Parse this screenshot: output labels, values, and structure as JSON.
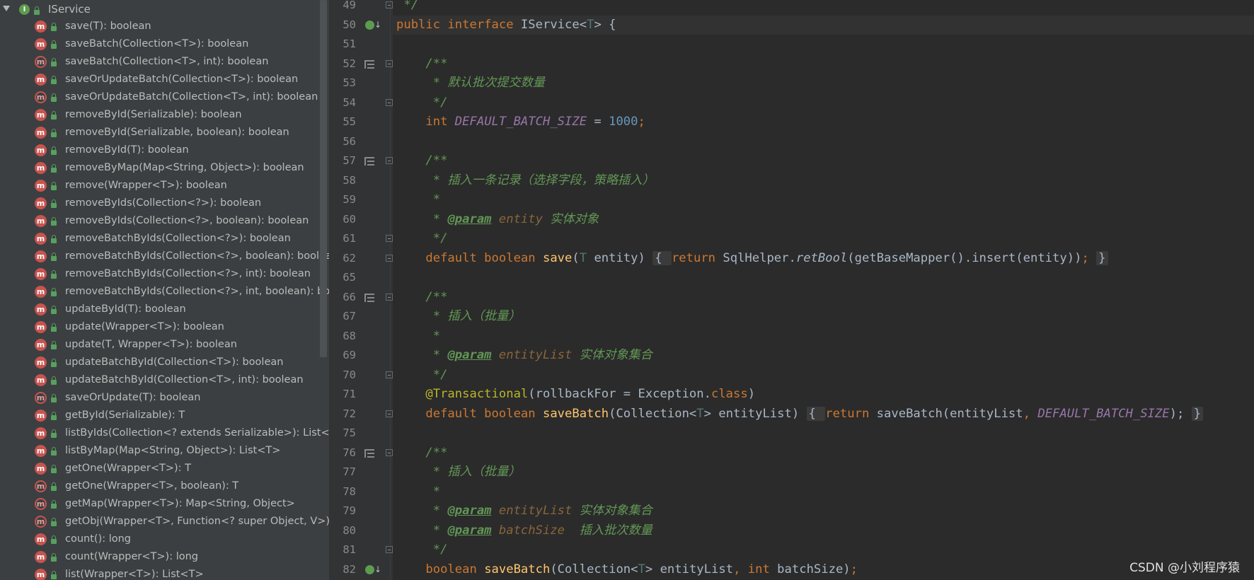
{
  "structure": {
    "root_label": "IService",
    "root_icon_letter": "I",
    "members": [
      {
        "label": "save(T): boolean",
        "abstract": false
      },
      {
        "label": "saveBatch(Collection<T>): boolean",
        "abstract": false
      },
      {
        "label": "saveBatch(Collection<T>, int): boolean",
        "abstract": true
      },
      {
        "label": "saveOrUpdateBatch(Collection<T>): boolean",
        "abstract": false
      },
      {
        "label": "saveOrUpdateBatch(Collection<T>, int): boolean",
        "abstract": true
      },
      {
        "label": "removeById(Serializable): boolean",
        "abstract": false
      },
      {
        "label": "removeById(Serializable, boolean): boolean",
        "abstract": false
      },
      {
        "label": "removeById(T): boolean",
        "abstract": false
      },
      {
        "label": "removeByMap(Map<String, Object>): boolean",
        "abstract": false
      },
      {
        "label": "remove(Wrapper<T>): boolean",
        "abstract": false
      },
      {
        "label": "removeByIds(Collection<?>): boolean",
        "abstract": false
      },
      {
        "label": "removeByIds(Collection<?>, boolean): boolean",
        "abstract": false
      },
      {
        "label": "removeBatchByIds(Collection<?>): boolean",
        "abstract": false
      },
      {
        "label": "removeBatchByIds(Collection<?>, boolean): boolea",
        "abstract": false
      },
      {
        "label": "removeBatchByIds(Collection<?>, int): boolean",
        "abstract": false
      },
      {
        "label": "removeBatchByIds(Collection<?>, int, boolean): bo",
        "abstract": false
      },
      {
        "label": "updateById(T): boolean",
        "abstract": false
      },
      {
        "label": "update(Wrapper<T>): boolean",
        "abstract": false
      },
      {
        "label": "update(T, Wrapper<T>): boolean",
        "abstract": false
      },
      {
        "label": "updateBatchById(Collection<T>): boolean",
        "abstract": false
      },
      {
        "label": "updateBatchById(Collection<T>, int): boolean",
        "abstract": false
      },
      {
        "label": "saveOrUpdate(T): boolean",
        "abstract": true
      },
      {
        "label": "getById(Serializable): T",
        "abstract": false
      },
      {
        "label": "listByIds(Collection<? extends Serializable>): List<T",
        "abstract": false
      },
      {
        "label": "listByMap(Map<String, Object>): List<T>",
        "abstract": false
      },
      {
        "label": "getOne(Wrapper<T>): T",
        "abstract": false
      },
      {
        "label": "getOne(Wrapper<T>, boolean): T",
        "abstract": true
      },
      {
        "label": "getMap(Wrapper<T>): Map<String, Object>",
        "abstract": true
      },
      {
        "label": "getObj(Wrapper<T>, Function<? super Object, V>)",
        "abstract": true
      },
      {
        "label": "count(): long",
        "abstract": false
      },
      {
        "label": "count(Wrapper<T>): long",
        "abstract": false
      },
      {
        "label": "list(Wrapper<T>): List<T>",
        "abstract": false
      }
    ],
    "member_icon_letter": "m"
  },
  "editor": {
    "line_numbers": [
      "49",
      "50",
      "51",
      "52",
      "53",
      "54",
      "55",
      "56",
      "57",
      "58",
      "59",
      "60",
      "61",
      "62",
      "65",
      "66",
      "67",
      "68",
      "69",
      "70",
      "71",
      "72",
      "75",
      "76",
      "77",
      "78",
      "79",
      "80",
      "81",
      "82"
    ],
    "lines": [
      [
        {
          "t": " */",
          "c": "doc"
        }
      ],
      [
        {
          "t": "public interface ",
          "c": "kw"
        },
        {
          "t": "IService",
          "c": "type"
        },
        {
          "t": "<",
          "c": ""
        },
        {
          "t": "T",
          "c": "tp"
        },
        {
          "t": "> {",
          "c": ""
        }
      ],
      [],
      [
        {
          "t": "    /**",
          "c": "doc"
        }
      ],
      [
        {
          "t": "     * 默认批次提交数量",
          "c": "doc"
        }
      ],
      [
        {
          "t": "     */",
          "c": "doc"
        }
      ],
      [
        {
          "t": "    int ",
          "c": "kw"
        },
        {
          "t": "DEFAULT_BATCH_SIZE",
          "c": "const"
        },
        {
          "t": " = ",
          "c": ""
        },
        {
          "t": "1000",
          "c": "num"
        },
        {
          "t": ";",
          "c": "kw"
        }
      ],
      [],
      [
        {
          "t": "    /**",
          "c": "doc"
        }
      ],
      [
        {
          "t": "     * 插入一条记录（选择字段，策略插入）",
          "c": "doc"
        }
      ],
      [
        {
          "t": "     *",
          "c": "doc"
        }
      ],
      [
        {
          "t": "     * ",
          "c": "doc"
        },
        {
          "t": "@param",
          "c": "tag"
        },
        {
          "t": " ",
          "c": "doc"
        },
        {
          "t": "entity",
          "c": "pname"
        },
        {
          "t": " 实体对象",
          "c": "doc"
        }
      ],
      [
        {
          "t": "     */",
          "c": "doc"
        }
      ],
      [
        {
          "t": "    default boolean ",
          "c": "kw"
        },
        {
          "t": "save",
          "c": "fn"
        },
        {
          "t": "(",
          "c": ""
        },
        {
          "t": "T",
          "c": "tp"
        },
        {
          "t": " entity) ",
          "c": ""
        },
        {
          "t": "{ ",
          "c": "fold"
        },
        {
          "t": "return ",
          "c": "kw"
        },
        {
          "t": "SqlHelper.",
          "c": ""
        },
        {
          "t": "retBool",
          "c": "stat"
        },
        {
          "t": "(getBaseMapper().insert(entity))",
          "c": ""
        },
        {
          "t": "; ",
          "c": "kw"
        },
        {
          "t": "}",
          "c": "fold"
        }
      ],
      [],
      [
        {
          "t": "    /**",
          "c": "doc"
        }
      ],
      [
        {
          "t": "     * 插入（批量）",
          "c": "doc"
        }
      ],
      [
        {
          "t": "     *",
          "c": "doc"
        }
      ],
      [
        {
          "t": "     * ",
          "c": "doc"
        },
        {
          "t": "@param",
          "c": "tag"
        },
        {
          "t": " ",
          "c": "doc"
        },
        {
          "t": "entityList",
          "c": "pname"
        },
        {
          "t": " 实体对象集合",
          "c": "doc"
        }
      ],
      [
        {
          "t": "     */",
          "c": "doc"
        }
      ],
      [
        {
          "t": "    @Transactional",
          "c": "ann"
        },
        {
          "t": "(rollbackFor = Exception.",
          "c": ""
        },
        {
          "t": "class",
          "c": "kw"
        },
        {
          "t": ")",
          "c": ""
        }
      ],
      [
        {
          "t": "    default boolean ",
          "c": "kw"
        },
        {
          "t": "saveBatch",
          "c": "fn"
        },
        {
          "t": "(Collection<",
          "c": ""
        },
        {
          "t": "T",
          "c": "tp"
        },
        {
          "t": "> entityList) ",
          "c": ""
        },
        {
          "t": "{ ",
          "c": "fold"
        },
        {
          "t": "return ",
          "c": "kw"
        },
        {
          "t": "saveBatch(entityList",
          "c": ""
        },
        {
          "t": ", ",
          "c": "kw"
        },
        {
          "t": "DEFAULT_BATCH_SIZE",
          "c": "const"
        },
        {
          "t": "); ",
          "c": ""
        },
        {
          "t": "}",
          "c": "fold"
        }
      ],
      [],
      [
        {
          "t": "    /**",
          "c": "doc"
        }
      ],
      [
        {
          "t": "     * 插入（批量）",
          "c": "doc"
        }
      ],
      [
        {
          "t": "     *",
          "c": "doc"
        }
      ],
      [
        {
          "t": "     * ",
          "c": "doc"
        },
        {
          "t": "@param",
          "c": "tag"
        },
        {
          "t": " ",
          "c": "doc"
        },
        {
          "t": "entityList",
          "c": "pname"
        },
        {
          "t": " 实体对象集合",
          "c": "doc"
        }
      ],
      [
        {
          "t": "     * ",
          "c": "doc"
        },
        {
          "t": "@param",
          "c": "tag"
        },
        {
          "t": " ",
          "c": "doc"
        },
        {
          "t": "batchSize",
          "c": "pname"
        },
        {
          "t": "  插入批次数量",
          "c": "doc"
        }
      ],
      [
        {
          "t": "     */",
          "c": "doc"
        }
      ],
      [
        {
          "t": "    boolean ",
          "c": "kw"
        },
        {
          "t": "saveBatch",
          "c": "fn"
        },
        {
          "t": "(Collection<",
          "c": ""
        },
        {
          "t": "T",
          "c": "tp"
        },
        {
          "t": "> entityList",
          "c": ""
        },
        {
          "t": ", ",
          "c": "kw"
        },
        {
          "t": "int ",
          "c": "kw"
        },
        {
          "t": "batchSize)",
          "c": ""
        },
        {
          "t": ";",
          "c": "kw"
        }
      ]
    ],
    "current_line": "50",
    "doc_icon_lines": [
      "52",
      "57",
      "66",
      "76"
    ],
    "implement_icon_lines": [
      "50",
      "82"
    ],
    "fold_lines": [
      "49",
      "52",
      "54",
      "57",
      "61",
      "62",
      "66",
      "70",
      "72",
      "76",
      "81"
    ]
  },
  "watermark": "CSDN @小刘程序猿"
}
